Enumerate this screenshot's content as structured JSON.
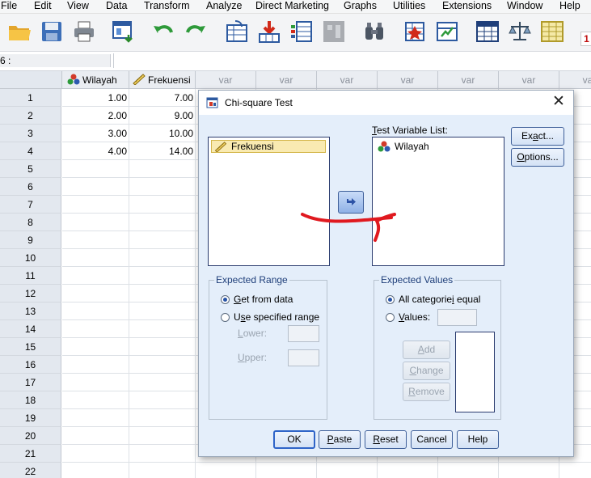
{
  "menu": {
    "items": [
      "File",
      "Edit",
      "View",
      "Data",
      "Transform",
      "Analyze",
      "Direct Marketing",
      "Graphs",
      "Utilities",
      "Extensions",
      "Window",
      "Help"
    ]
  },
  "toolbar": {
    "icons": [
      "open-folder-icon",
      "save-icon",
      "print-icon",
      "dialog-recall-icon",
      "undo-icon",
      "redo-icon",
      "goto-case-icon",
      "goto-variable-icon",
      "variables-icon",
      "run-descriptives-icon",
      "find-icon",
      "insert-cases-icon",
      "insert-variable-icon",
      "split-file-icon",
      "weight-cases-icon",
      "select-cases-icon"
    ],
    "badge": "1"
  },
  "refbar": {
    "cell_ref": "6 :"
  },
  "grid": {
    "columns": [
      "Wilayah",
      "Frekuensi",
      "var",
      "var",
      "var",
      "var",
      "var",
      "var",
      "var"
    ],
    "row_numbers": [
      "1",
      "2",
      "3",
      "4",
      "5",
      "6",
      "7",
      "8",
      "9",
      "10",
      "11",
      "12",
      "13",
      "14",
      "15",
      "16",
      "17",
      "18",
      "19",
      "20",
      "21",
      "22"
    ],
    "wilayah": [
      "1.00",
      "2.00",
      "3.00",
      "4.00"
    ],
    "frekuensi": [
      "7.00",
      "9.00",
      "10.00",
      "14.00"
    ]
  },
  "dialog": {
    "title": "Chi-square Test",
    "source_list": [
      "Frekuensi"
    ],
    "test_variable_label": "Test Variable List:",
    "test_variables": [
      "Wilayah"
    ],
    "buttons": {
      "exact": "Exact...",
      "options": "Options...",
      "ok": "OK",
      "paste": "Paste",
      "reset": "Reset",
      "cancel": "Cancel",
      "help": "Help"
    },
    "expected_range": {
      "title": "Expected Range",
      "get_from_data": "Get from data",
      "use_specified": "Use specified range",
      "lower": "Lower:",
      "upper": "Upper:",
      "selected": "get_from_data"
    },
    "expected_values": {
      "title": "Expected Values",
      "all_equal": "All categories equal",
      "values": "Values:",
      "add": "Add",
      "change": "Change",
      "remove": "Remove",
      "selected": "all_equal"
    },
    "annotation_color": "#e0191f"
  }
}
